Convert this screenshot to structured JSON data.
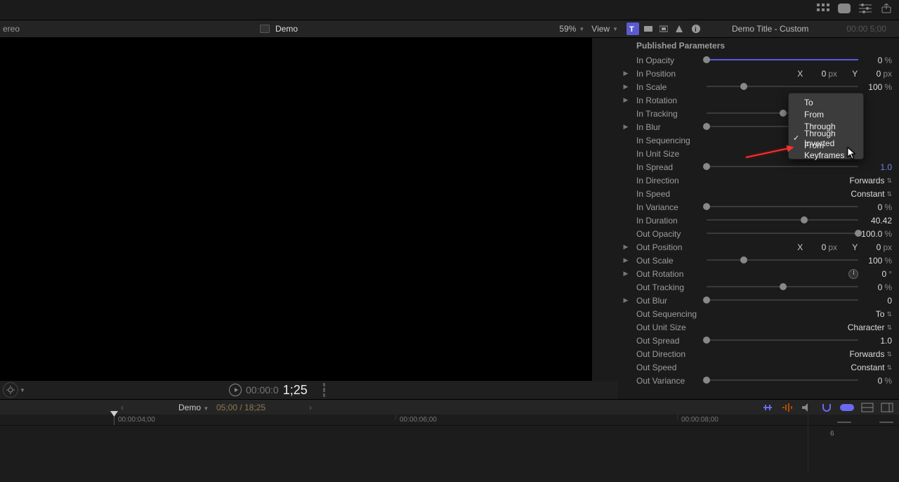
{
  "header": {
    "stereo_label": "ereo",
    "clip_name": "Demo",
    "zoom": "59%",
    "view_label": "View",
    "title": "Demo Title - Custom",
    "tc": "00:00 5;00"
  },
  "transport": {
    "small_time": "00:00:0",
    "big_time": "1;25"
  },
  "browser": {
    "clip": "Demo",
    "range": "05;00 / 18;25"
  },
  "timeline": {
    "label_a": "00:00:04;00",
    "label_b": "00:00:06;00",
    "label_c": "00:00:08;00",
    "audio_level": "6"
  },
  "inspector": {
    "section": "Published Parameters",
    "rows": {
      "in_opacity": {
        "label": "In Opacity",
        "value": "0",
        "unit": "%"
      },
      "in_position": {
        "label": "In Position",
        "x": "0",
        "xunit": "px",
        "y": "0",
        "yunit": "px"
      },
      "in_scale": {
        "label": "In Scale",
        "value": "100",
        "unit": "%"
      },
      "in_rotation": {
        "label": "In Rotation"
      },
      "in_tracking": {
        "label": "In Tracking"
      },
      "in_blur": {
        "label": "In Blur"
      },
      "in_sequencing": {
        "label": "In Sequencing"
      },
      "in_unit_size": {
        "label": "In Unit Size"
      },
      "in_spread": {
        "label": "In Spread",
        "value": "1.0"
      },
      "in_direction": {
        "label": "In Direction",
        "value": "Forwards"
      },
      "in_speed": {
        "label": "In Speed",
        "value": "Constant"
      },
      "in_variance": {
        "label": "In Variance",
        "value": "0",
        "unit": "%"
      },
      "in_duration": {
        "label": "In Duration",
        "value": "40.42"
      },
      "out_opacity": {
        "label": "Out Opacity",
        "value": "100.0",
        "unit": "%"
      },
      "out_position": {
        "label": "Out Position",
        "x": "0",
        "xunit": "px",
        "y": "0",
        "yunit": "px"
      },
      "out_scale": {
        "label": "Out Scale",
        "value": "100",
        "unit": "%"
      },
      "out_rotation": {
        "label": "Out Rotation",
        "value": "0",
        "unit": "°"
      },
      "out_tracking": {
        "label": "Out Tracking",
        "value": "0",
        "unit": "%"
      },
      "out_blur": {
        "label": "Out Blur",
        "value": "0"
      },
      "out_sequencing": {
        "label": "Out Sequencing",
        "value": "To"
      },
      "out_unit_size": {
        "label": "Out Unit Size",
        "value": "Character"
      },
      "out_spread": {
        "label": "Out Spread",
        "value": "1.0"
      },
      "out_direction": {
        "label": "Out Direction",
        "value": "Forwards"
      },
      "out_speed": {
        "label": "Out Speed",
        "value": "Constant"
      },
      "out_variance": {
        "label": "Out Variance",
        "value": "0",
        "unit": "%"
      }
    }
  },
  "menu": {
    "items": [
      "To",
      "From",
      "Through",
      "Through Inverted",
      "From Keyframes"
    ],
    "selected": 3,
    "highlight": 4
  }
}
